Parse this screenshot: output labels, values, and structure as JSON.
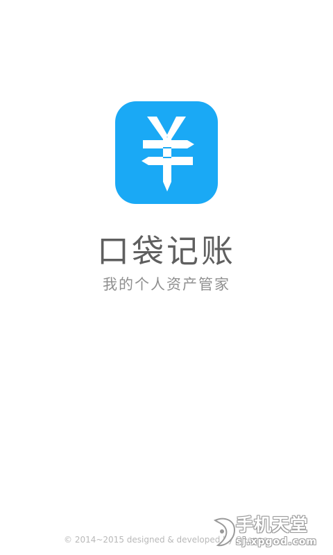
{
  "splash": {
    "app_name": "口袋记账",
    "slogan": "我的个人资产管家",
    "copyright": "© 2014~2015 designed & developed by Qeenao",
    "icon": "yuan-pencil-icon",
    "accent_color": "#1aa9f5",
    "background_color": "#ffffff"
  },
  "watermark": {
    "title": "手机天堂",
    "url": "sj.xpgod.com",
    "icon": "watermark-logo"
  }
}
